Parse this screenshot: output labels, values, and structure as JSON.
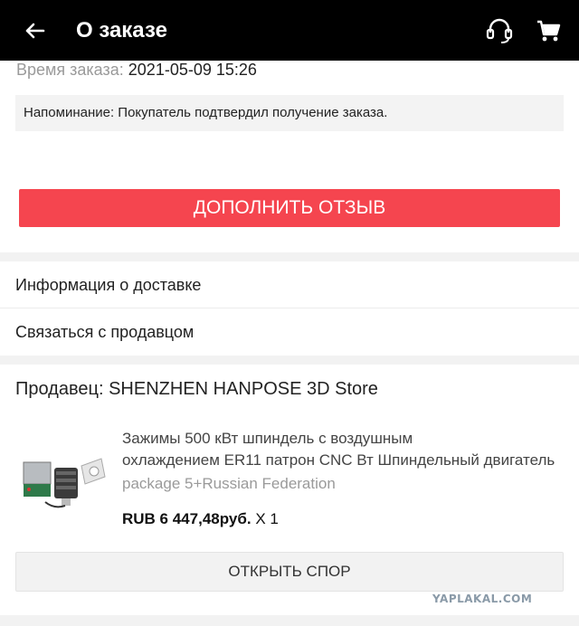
{
  "header": {
    "title": "О заказе",
    "icons": {
      "back": "arrow-left-icon",
      "support": "headset-icon",
      "cart": "cart-icon"
    }
  },
  "order": {
    "time_label": "Время заказа:",
    "time_value": "2021-05-09 15:26",
    "reminder": "Напоминание: Покупатель подтвердил получение заказа.",
    "review_button": "ДОПОЛНИТЬ ОТЗЫВ"
  },
  "links": {
    "delivery_info": "Информация о доставке",
    "contact_seller": "Связаться с продавцом"
  },
  "seller": {
    "label": "Продавец: SHENZHEN HANPOSE 3D Store"
  },
  "product": {
    "name_line1": "Зажимы 500 кВт шпиндель с воздушным",
    "name_line2": "охлаждением ER11 патрон CNC Вт Шпиндельный двигатель",
    "variant": "package 5+Russian Federation",
    "price": "RUB 6 447,48руб.",
    "quantity": "X 1",
    "image_icon": "spindle-kit-thumbnail"
  },
  "dispute_button": "ОТКРЫТЬ СПОР",
  "watermark": "YAPLAKAL.COM",
  "colors": {
    "topbar": "#000000",
    "accent_red": "#f5454f",
    "muted_text": "#9a9a9a",
    "background": "#f2f2f2"
  }
}
